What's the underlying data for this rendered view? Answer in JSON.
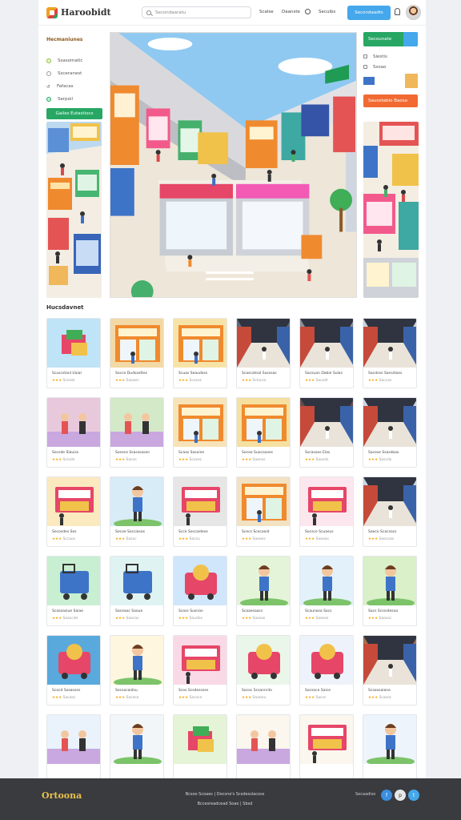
{
  "header": {
    "brand": "Haroobidt",
    "search_placeholder": "Secondaaratu",
    "nav": [
      "Scalse",
      "Daanste",
      "Secuibs"
    ],
    "cta": "Secondaadts"
  },
  "filters": {
    "title": "Hecmaniunes",
    "items": [
      "Ssasomatic",
      "Ssceranest",
      "Fafacas",
      "Serpoil"
    ],
    "button": "Gailes Eutastiocs"
  },
  "right_panel": {
    "button": "Secounate",
    "items": [
      "Siestis",
      "Ssoao"
    ],
    "button2": "Sauostabio Baosa"
  },
  "section": {
    "title": "Hucsdavnet"
  },
  "cards": [
    {
      "title": "Scuscstanl Uaial",
      "rating": "Sciodo",
      "bg": "#bfe3f7",
      "kind": "boxes"
    },
    {
      "title": "Socce Dudsasttes",
      "rating": "Saeaec",
      "bg": "#f3d9a6",
      "kind": "store"
    },
    {
      "title": "Scuas Seaudoss",
      "rating": "Scesoc",
      "bg": "#f7e3a8",
      "kind": "store"
    },
    {
      "title": "Scascatnal Susssas",
      "rating": "Sclocso",
      "bg": "#5d6a7e",
      "kind": "mall"
    },
    {
      "title": "Sacsuan Dabie Sulas",
      "rating": "Sacodl",
      "bg": "#8c8f99",
      "kind": "mall"
    },
    {
      "title": "Sacdcos Sansdiass",
      "rating": "Saccas",
      "bg": "#c6d3de",
      "kind": "mall"
    },
    {
      "title": "Secsde Slauiss",
      "rating": "Sciode",
      "bg": "#e8c9dc",
      "kind": "people"
    },
    {
      "title": "Sosece Ssasssasen",
      "rating": "Sacos",
      "bg": "#d4e9c8",
      "kind": "people"
    },
    {
      "title": "Scaas Sasoine",
      "rating": "Scosec",
      "bg": "#f7e3b8",
      "kind": "store"
    },
    {
      "title": "Socoe Suocasoes",
      "rating": "Saecos",
      "bg": "#f5e0a0",
      "kind": "store"
    },
    {
      "title": "Sscasoos Elas",
      "rating": "Saosds",
      "bg": "#6a4b52",
      "kind": "mall"
    },
    {
      "title": "Sacsoe Ssasdoas",
      "rating": "Sascds",
      "bg": "#c9d6e4",
      "kind": "mall"
    },
    {
      "title": "Secosdes Ses",
      "rating": "Sccaoc",
      "bg": "#fbe9c0",
      "kind": "sign"
    },
    {
      "title": "Secoe Socsiasas",
      "rating": "Sasoc",
      "bg": "#d7ecf7",
      "kind": "kid"
    },
    {
      "title": "Scce Ssscaidese",
      "rating": "Sacsu",
      "bg": "#e6e6e6",
      "kind": "sign"
    },
    {
      "title": "Scecs Scocaoid",
      "rating": "Saoees",
      "bg": "#f2e2c2",
      "kind": "store"
    },
    {
      "title": "Socsce Scuasus",
      "rating": "Saeoas",
      "bg": "#fde7ee",
      "kind": "sign"
    },
    {
      "title": "Saeco Scacsacs",
      "rating": "Saecoas",
      "bg": "#c5d7e8",
      "kind": "mall"
    },
    {
      "title": "Scasoasiue Saiae",
      "rating": "Saascde",
      "bg": "#c9efd2",
      "kind": "cart"
    },
    {
      "title": "Saceaoc Saoue",
      "rating": "Saecas",
      "bg": "#dff3f2",
      "kind": "cart"
    },
    {
      "title": "Scoss Susnan",
      "rating": "Saudas",
      "bg": "#cfe6fb",
      "kind": "toy"
    },
    {
      "title": "Scaaesaacs",
      "rating": "Saosas",
      "bg": "#e4f4d8",
      "kind": "kid"
    },
    {
      "title": "Scaunosa Sacs",
      "rating": "Saesos",
      "bg": "#e3f1fb",
      "kind": "kid"
    },
    {
      "title": "Sacs Srcssdesoa",
      "rating": "Saesoc",
      "bg": "#d9f0c8",
      "kind": "kid"
    },
    {
      "title": "Scocd Sosasoss",
      "rating": "Sacaoc",
      "bg": "#5aa9dc",
      "kind": "toy"
    },
    {
      "title": "Secsocaidsu",
      "rating": "Sacaso",
      "bg": "#fff6df",
      "kind": "kid"
    },
    {
      "title": "Scos Scsdessses",
      "rating": "Sacsce",
      "bg": "#f9d9e6",
      "kind": "sign"
    },
    {
      "title": "Sococ Scsanrcdo",
      "rating": "Saaeou",
      "bg": "#eaf6ea",
      "kind": "toy"
    },
    {
      "title": "Socsoce Saice",
      "rating": "Sacss",
      "bg": "#eef3fb",
      "kind": "toy"
    },
    {
      "title": "Scsoosaiane",
      "rating": "Scasoc",
      "bg": "#a86f4a",
      "kind": "mall"
    },
    {
      "title": "",
      "rating": "",
      "bg": "#eaf3fb",
      "kind": "people"
    },
    {
      "title": "",
      "rating": "",
      "bg": "#f3f6f9",
      "kind": "kid"
    },
    {
      "title": "",
      "rating": "",
      "bg": "#e5f3d6",
      "kind": "boxes"
    },
    {
      "title": "",
      "rating": "",
      "bg": "#fbf6ee",
      "kind": "people"
    },
    {
      "title": "",
      "rating": "",
      "bg": "#fbf6ee",
      "kind": "sign"
    },
    {
      "title": "",
      "rating": "",
      "bg": "#eef4fb",
      "kind": "kid"
    }
  ],
  "footer": {
    "brand": "Ortoona",
    "links_line1": "Bcsoo Scoaes | Docsne's Scsdesslacoss",
    "links_line2": "Bccesreadcead Soao | Sbsd",
    "follow": "Secaadiso"
  },
  "colors": {
    "accent_blue": "#45a7ec",
    "green": "#27a763",
    "orange": "#f26a32",
    "footer": "#3a3b3f",
    "star": "#f3a81a"
  }
}
